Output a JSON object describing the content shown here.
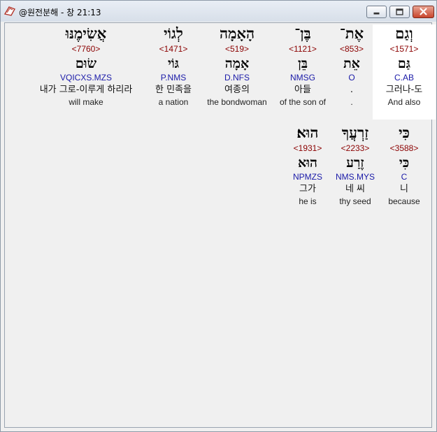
{
  "window": {
    "title": "@원전분해 - 창 21:13",
    "controls": {
      "minimize": "minimize",
      "maximize": "maximize",
      "close": "close"
    }
  },
  "verse": {
    "line1": [
      {
        "hebrew": "וְגַם",
        "strong": "<1571>",
        "root": "גַּם",
        "parse": "C.AB",
        "korean": "그러나-도",
        "english": "And also"
      },
      {
        "hebrew": "אֶת־",
        "strong": "<853>",
        "root": "אֵת",
        "parse": "O",
        "korean": ".",
        "english": "."
      },
      {
        "hebrew": "בֶּן־",
        "strong": "<1121>",
        "root": "בֵּן",
        "parse": "NMSG",
        "korean": "아들",
        "english": "of the son of"
      },
      {
        "hebrew": "הָאָמָה",
        "strong": "<519>",
        "root": "אָמָה",
        "parse": "D.NFS",
        "korean": "여종의",
        "english": "the bondwoman"
      },
      {
        "hebrew": "לְגוֹי",
        "strong": "<1471>",
        "root": "גּוֹי",
        "parse": "P.NMS",
        "korean": "한 민족을",
        "english": "a nation"
      },
      {
        "hebrew": "אֲשִׂימֶנּוּ",
        "strong": "<7760>",
        "root": "שׂוּם",
        "parse": "VQICXS.MZS",
        "korean": "내가 그로-이루게 하리라",
        "english": "will make"
      }
    ],
    "line2": [
      {
        "hebrew": "כִּי",
        "strong": "<3588>",
        "root": "כִּי",
        "parse": "C",
        "korean": "니",
        "english": "because"
      },
      {
        "hebrew": "זַרְעֲךָ",
        "strong": "<2233>",
        "root": "זֶרַע",
        "parse": "NMS.MYS",
        "korean": "네 씨",
        "english": "thy seed"
      },
      {
        "hebrew": "הוּא׃",
        "strong": "<1931>",
        "root": "הוּא",
        "parse": "NPMZS",
        "korean": "그가",
        "english": "he is"
      }
    ]
  }
}
